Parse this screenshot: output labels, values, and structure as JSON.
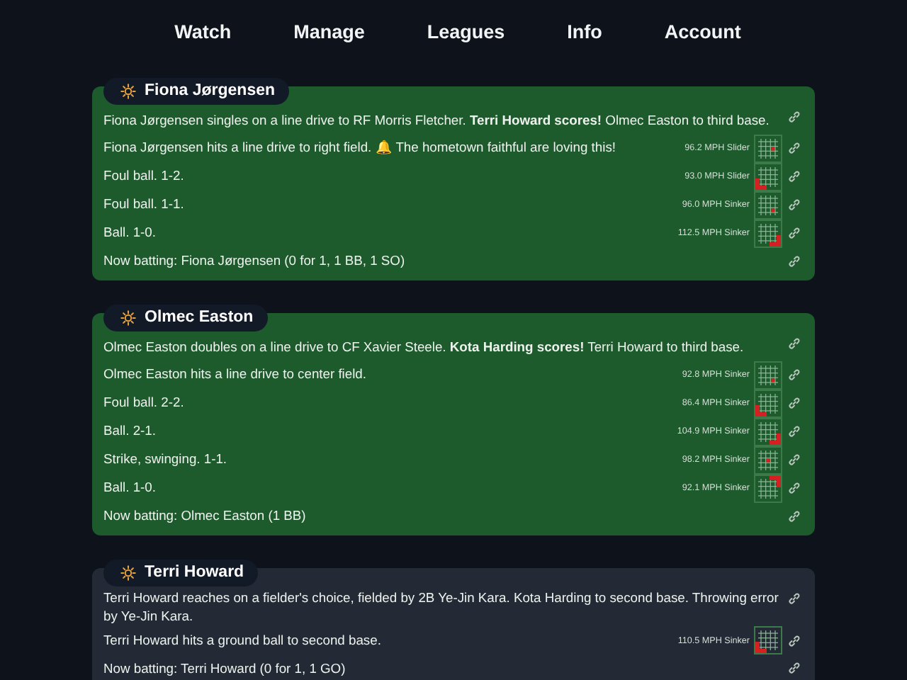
{
  "nav": [
    {
      "label": "Watch"
    },
    {
      "label": "Manage"
    },
    {
      "label": "Leagues"
    },
    {
      "label": "Info"
    },
    {
      "label": "Account"
    }
  ],
  "cards": [
    {
      "batter": "Fiona Jørgensen",
      "scoring": true,
      "rows": [
        {
          "text": "Fiona Jørgensen singles on a line drive to RF Morris Fletcher. **Terri Howard scores!** Olmec Easton to third base."
        },
        {
          "text": "Fiona Jørgensen hits a line drive to right field. 🔔 The hometown faithful are loving this!",
          "pitch": "96.2 MPH Slider",
          "kind": "midright"
        },
        {
          "text": "Foul ball. 1-2.",
          "pitch": "93.0 MPH Slider",
          "kind": "balllowleft"
        },
        {
          "text": "Foul ball. 1-1.",
          "pitch": "96.0 MPH Sinker",
          "kind": "lowright"
        },
        {
          "text": "Ball. 1-0.",
          "pitch": "112.5 MPH Sinker",
          "kind": "balllowright"
        },
        {
          "text": "Now batting: Fiona Jørgensen (0 for 1, 1 BB, 1 SO)"
        }
      ]
    },
    {
      "batter": "Olmec Easton",
      "scoring": true,
      "rows": [
        {
          "text": "Olmec Easton doubles on a line drive to CF Xavier Steele. **Kota Harding scores!** Terri Howard to third base."
        },
        {
          "text": "Olmec Easton hits a line drive to center field.",
          "pitch": "92.8 MPH Sinker",
          "kind": "lowright"
        },
        {
          "text": "Foul ball. 2-2.",
          "pitch": "86.4 MPH Sinker",
          "kind": "balllowleft"
        },
        {
          "text": "Ball. 2-1.",
          "pitch": "104.9 MPH Sinker",
          "kind": "balllowright"
        },
        {
          "text": "Strike, swinging. 1-1.",
          "pitch": "98.2 MPH Sinker",
          "kind": "center"
        },
        {
          "text": "Ball. 1-0.",
          "pitch": "92.1 MPH Sinker",
          "kind": "ballhighright"
        },
        {
          "text": "Now batting: Olmec Easton (1 BB)"
        }
      ]
    },
    {
      "batter": "Terri Howard",
      "scoring": false,
      "rows": [
        {
          "text": "Terri Howard reaches on a fielder's choice, fielded by 2B Ye-Jin Kara. Kota Harding to second base. Throwing error by Ye-Jin Kara."
        },
        {
          "text": "Terri Howard hits a ground ball to second base.",
          "pitch": "110.5 MPH Sinker",
          "kind": "balllowleft"
        },
        {
          "text": "Now batting: Terri Howard (0 for 1, 1 GO)"
        }
      ]
    }
  ]
}
